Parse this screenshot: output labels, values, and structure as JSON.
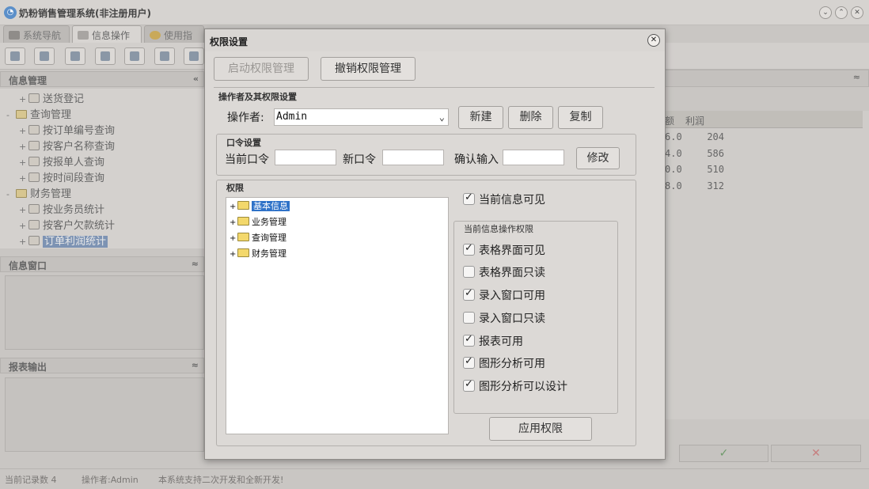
{
  "app": {
    "title": "奶粉销售管理系统(非注册用户)",
    "tabs": [
      {
        "label": "系统导航"
      },
      {
        "label": "信息操作"
      },
      {
        "label": "使用指南"
      }
    ]
  },
  "left_panel": {
    "title": "信息管理",
    "tree": [
      {
        "label": "送货登记",
        "expander": "+"
      },
      {
        "label": "查询管理",
        "expander": "-"
      },
      {
        "label": "按订单编号查询",
        "expander": "+"
      },
      {
        "label": "按客户名称查询",
        "expander": "+"
      },
      {
        "label": "按报单人查询",
        "expander": "+"
      },
      {
        "label": "按时间段查询",
        "expander": "+"
      },
      {
        "label": "财务管理",
        "expander": "-"
      },
      {
        "label": "按业务员统计",
        "expander": "+"
      },
      {
        "label": "按客户欠款统计",
        "expander": "+"
      },
      {
        "label": "订单利润统计",
        "expander": "+"
      }
    ],
    "info_window_title": "信息窗口",
    "report_output_title": "报表输出"
  },
  "grid": {
    "headers": [
      "额",
      "利润"
    ],
    "rows": [
      {
        "amount": "6.0",
        "profit": "204"
      },
      {
        "amount": "4.0",
        "profit": "586"
      },
      {
        "amount": "0.0",
        "profit": "510"
      },
      {
        "amount": "8.0",
        "profit": "312"
      }
    ],
    "confirm_symbol": "✓",
    "cancel_symbol": "✕"
  },
  "status_bar": {
    "record_count": "当前记录数 4",
    "operator": "操作者:Admin",
    "message": "本系统支持二次开发和全新开发!"
  },
  "dialog": {
    "title": "权限设置",
    "close_symbol": "✕",
    "enable_btn": "启动权限管理",
    "revoke_btn": "撤销权限管理",
    "operator_section": "操作者及其权限设置",
    "operator_label": "操作者:",
    "operator_value": "Admin",
    "new_btn": "新建",
    "delete_btn": "删除",
    "copy_btn": "复制",
    "password_section": "口令设置",
    "current_pwd_label": "当前口令",
    "new_pwd_label": "新口令",
    "confirm_pwd_label": "确认输入",
    "modify_btn": "修改",
    "permission_section": "权限",
    "perm_tree": [
      {
        "label": "基本信息",
        "expander": "+"
      },
      {
        "label": "业务管理",
        "expander": "+"
      },
      {
        "label": "查询管理",
        "expander": "+"
      },
      {
        "label": "财务管理",
        "expander": "+"
      }
    ],
    "current_visible": {
      "label": "当前信息可见",
      "checked": true
    },
    "ops_section": "当前信息操作权限",
    "ops": [
      {
        "label": "表格界面可见",
        "checked": true
      },
      {
        "label": "表格界面只读",
        "checked": false
      },
      {
        "label": "录入窗口可用",
        "checked": true
      },
      {
        "label": "录入窗口只读",
        "checked": false
      },
      {
        "label": "报表可用",
        "checked": true
      },
      {
        "label": "图形分析可用",
        "checked": true
      },
      {
        "label": "图形分析可以设计",
        "checked": true
      }
    ],
    "apply_btn": "应用权限"
  }
}
